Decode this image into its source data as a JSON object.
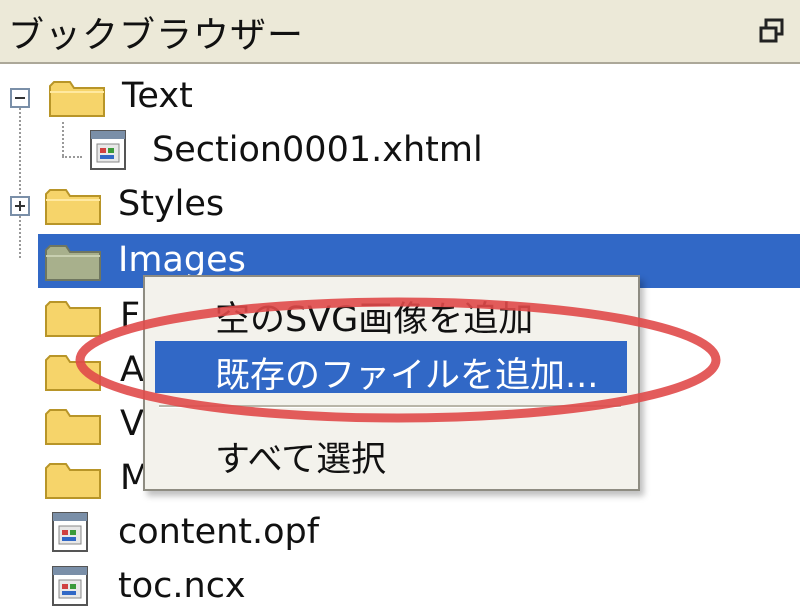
{
  "window": {
    "title": "ブックブラウザー",
    "float_icon": "restore-window-icon"
  },
  "tree": {
    "items": [
      {
        "label": "Text",
        "type": "folder",
        "expander": "minus"
      },
      {
        "label": "Section0001.xhtml",
        "type": "file"
      },
      {
        "label": "Styles",
        "type": "folder",
        "expander": "plus"
      },
      {
        "label": "Images",
        "type": "folder",
        "selected": true
      },
      {
        "label": "F",
        "type": "folder"
      },
      {
        "label": "A",
        "type": "folder"
      },
      {
        "label": "V",
        "type": "folder"
      },
      {
        "label": "Misc",
        "type": "folder"
      },
      {
        "label": "content.opf",
        "type": "file"
      },
      {
        "label": "toc.ncx",
        "type": "file"
      }
    ]
  },
  "context_menu": {
    "items": [
      {
        "label": "空のSVG画像を追加"
      },
      {
        "label": "既存のファイルを追加...",
        "highlighted": true
      },
      {
        "label": "すべて選択"
      }
    ]
  },
  "colors": {
    "selection": "#3168c6",
    "annotation": "#e04a4a",
    "folder": "#f6d46a"
  }
}
